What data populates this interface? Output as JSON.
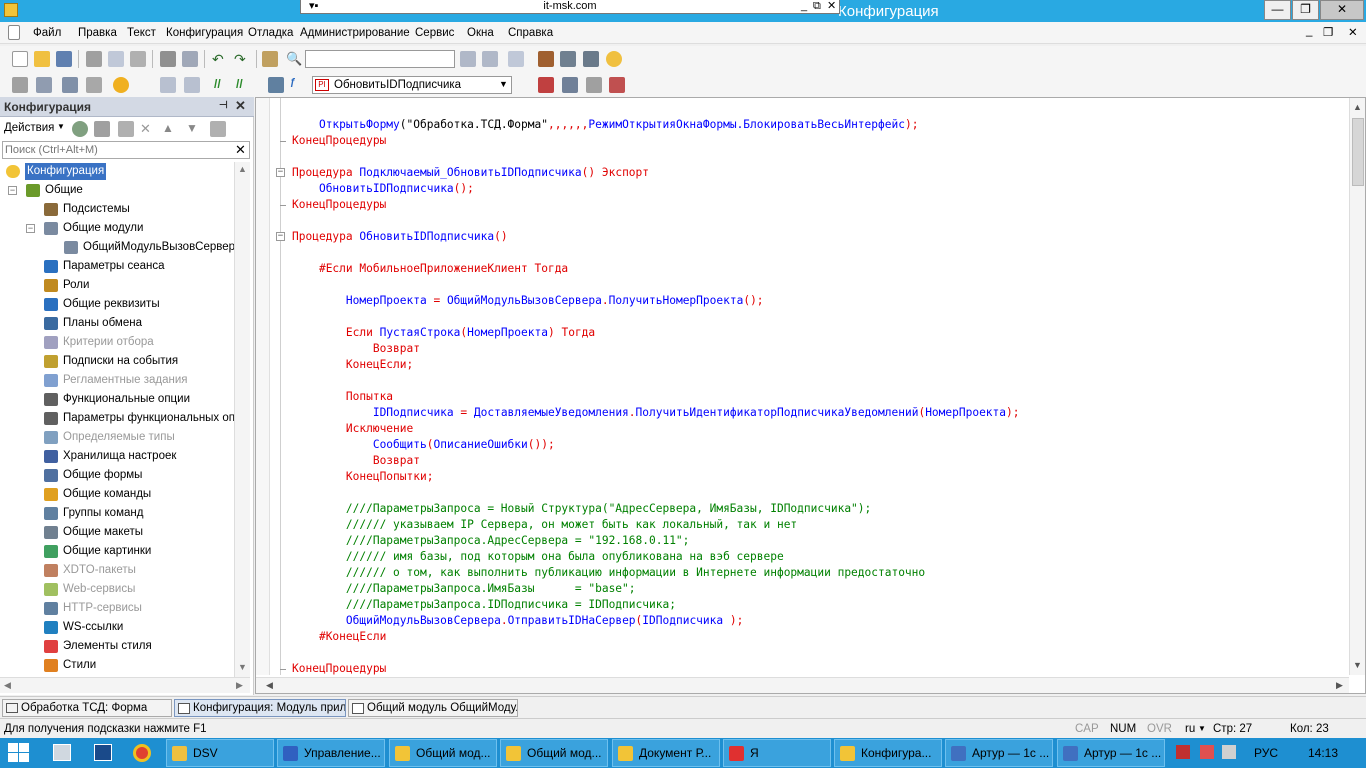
{
  "title_bar": {
    "title": "Конфигурация",
    "rdp_host": "it-msk.com"
  },
  "menu": [
    "Файл",
    "Правка",
    "Текст",
    "Конфигурация",
    "Отладка",
    "Администрирование",
    "Сервис",
    "Окна",
    "Справка"
  ],
  "toolbar": {
    "procedure_select": "ОбновитьIDПодписчика"
  },
  "left_panel": {
    "title": "Конфигурация",
    "actions_label": "Действия",
    "search_placeholder": "Поиск (Ctrl+Alt+M)",
    "tree": [
      {
        "label": "Конфигурация",
        "level": 0,
        "selected": true,
        "grey": false,
        "icon": "config-icon",
        "color": "#f2c437"
      },
      {
        "label": "Общие",
        "level": 0,
        "selected": false,
        "grey": false,
        "icon": "common-icon",
        "color": "#6b9a2a"
      },
      {
        "label": "Подсистемы",
        "level": 1,
        "selected": false,
        "grey": false,
        "icon": "subsystems-icon",
        "color": "#8a6a3a"
      },
      {
        "label": "Общие модули",
        "level": 1,
        "selected": false,
        "grey": false,
        "icon": "module-icon",
        "color": "#7a8aa0"
      },
      {
        "label": "ОбщийМодульВызовСервера",
        "level": 2,
        "selected": false,
        "grey": false,
        "icon": "module-icon",
        "color": "#7a8aa0"
      },
      {
        "label": "Параметры сеанса",
        "level": 1,
        "selected": false,
        "grey": false,
        "icon": "session-params-icon",
        "color": "#2a70c0"
      },
      {
        "label": "Роли",
        "level": 1,
        "selected": false,
        "grey": false,
        "icon": "roles-icon",
        "color": "#c08a20"
      },
      {
        "label": "Общие реквизиты",
        "level": 1,
        "selected": false,
        "grey": false,
        "icon": "attributes-icon",
        "color": "#2a70c0"
      },
      {
        "label": "Планы обмена",
        "level": 1,
        "selected": false,
        "grey": false,
        "icon": "exchange-icon",
        "color": "#3a6aa0"
      },
      {
        "label": "Критерии отбора",
        "level": 1,
        "selected": false,
        "grey": true,
        "icon": "filter-icon",
        "color": "#a0a0c0"
      },
      {
        "label": "Подписки на события",
        "level": 1,
        "selected": false,
        "grey": false,
        "icon": "events-icon",
        "color": "#c0a030"
      },
      {
        "label": "Регламентные задания",
        "level": 1,
        "selected": false,
        "grey": true,
        "icon": "schedule-icon",
        "color": "#80a0d0"
      },
      {
        "label": "Функциональные опции",
        "level": 1,
        "selected": false,
        "grey": false,
        "icon": "options-icon",
        "color": "#606060"
      },
      {
        "label": "Параметры функциональных опций",
        "level": 1,
        "selected": false,
        "grey": false,
        "icon": "options-params-icon",
        "color": "#606060"
      },
      {
        "label": "Определяемые типы",
        "level": 1,
        "selected": false,
        "grey": true,
        "icon": "types-icon",
        "color": "#80a0c0"
      },
      {
        "label": "Хранилища настроек",
        "level": 1,
        "selected": false,
        "grey": false,
        "icon": "storage-icon",
        "color": "#4060a0"
      },
      {
        "label": "Общие формы",
        "level": 1,
        "selected": false,
        "grey": false,
        "icon": "form-icon",
        "color": "#5070a0"
      },
      {
        "label": "Общие команды",
        "level": 1,
        "selected": false,
        "grey": false,
        "icon": "command-icon",
        "color": "#e0a020"
      },
      {
        "label": "Группы команд",
        "level": 1,
        "selected": false,
        "grey": false,
        "icon": "command-group-icon",
        "color": "#6080a0"
      },
      {
        "label": "Общие макеты",
        "level": 1,
        "selected": false,
        "grey": false,
        "icon": "template-icon",
        "color": "#708090"
      },
      {
        "label": "Общие картинки",
        "level": 1,
        "selected": false,
        "grey": false,
        "icon": "picture-icon",
        "color": "#40a060"
      },
      {
        "label": "XDTO-пакеты",
        "level": 1,
        "selected": false,
        "grey": true,
        "icon": "xdto-icon",
        "color": "#c08060"
      },
      {
        "label": "Web-сервисы",
        "level": 1,
        "selected": false,
        "grey": true,
        "icon": "web-service-icon",
        "color": "#a0c060"
      },
      {
        "label": "HTTP-сервисы",
        "level": 1,
        "selected": false,
        "grey": true,
        "icon": "http-service-icon",
        "color": "#6080a0"
      },
      {
        "label": "WS-ссылки",
        "level": 1,
        "selected": false,
        "grey": false,
        "icon": "ws-link-icon",
        "color": "#2080c0"
      },
      {
        "label": "Элементы стиля",
        "level": 1,
        "selected": false,
        "grey": false,
        "icon": "style-item-icon",
        "color": "#e04040"
      },
      {
        "label": "Стили",
        "level": 1,
        "selected": false,
        "grey": false,
        "icon": "styles-icon",
        "color": "#e08020"
      }
    ]
  },
  "editor": {
    "lines": [
      {
        "row": 1,
        "fold": "",
        "segs": [
          [
            "    ",
            "n"
          ],
          [
            "ОткрытьФорму",
            "id"
          ],
          [
            "(\"Обработка.ТСД.Форма\"",
            "n"
          ],
          [
            ",,,,,,",
            "op"
          ],
          [
            "РежимОткрытияОкнаФормы.БлокироватьВесьИнтерфейс",
            "id"
          ],
          [
            ");",
            "op"
          ]
        ]
      },
      {
        "row": 2,
        "fold": "end",
        "segs": [
          [
            "КонецПроцедуры",
            "kw"
          ]
        ]
      },
      {
        "row": 4,
        "fold": "minus",
        "segs": [
          [
            "Процедура ",
            "kw"
          ],
          [
            "Подключаемый_ОбновитьIDПодписчика",
            "id"
          ],
          [
            "() ",
            "op"
          ],
          [
            "Экспорт",
            "kw"
          ]
        ]
      },
      {
        "row": 5,
        "fold": "",
        "segs": [
          [
            "    ",
            "n"
          ],
          [
            "ОбновитьIDПодписчика",
            "id"
          ],
          [
            "();",
            "op"
          ]
        ]
      },
      {
        "row": 6,
        "fold": "end",
        "segs": [
          [
            "КонецПроцедуры",
            "kw"
          ]
        ]
      },
      {
        "row": 8,
        "fold": "minus",
        "segs": [
          [
            "Процедура ",
            "kw"
          ],
          [
            "ОбновитьIDПодписчика",
            "id"
          ],
          [
            "()",
            "op"
          ]
        ]
      },
      {
        "row": 10,
        "fold": "",
        "segs": [
          [
            "    ",
            "n"
          ],
          [
            "#Если МобильноеПриложениеКлиент Тогда",
            "kw"
          ]
        ]
      },
      {
        "row": 12,
        "fold": "",
        "segs": [
          [
            "        ",
            "n"
          ],
          [
            "НомерПроекта",
            "id"
          ],
          [
            " = ",
            "op"
          ],
          [
            "ОбщийМодульВызовСервера",
            "id"
          ],
          [
            ".",
            "op"
          ],
          [
            "ПолучитьНомерПроекта",
            "id"
          ],
          [
            "();",
            "op"
          ]
        ]
      },
      {
        "row": 14,
        "fold": "",
        "segs": [
          [
            "        ",
            "n"
          ],
          [
            "Если ",
            "kw"
          ],
          [
            "ПустаяСтрока",
            "id"
          ],
          [
            "(",
            "op"
          ],
          [
            "НомерПроекта",
            "id"
          ],
          [
            ") ",
            "op"
          ],
          [
            "Тогда",
            "kw"
          ]
        ]
      },
      {
        "row": 15,
        "fold": "",
        "segs": [
          [
            "            ",
            "n"
          ],
          [
            "Возврат",
            "kw"
          ]
        ]
      },
      {
        "row": 16,
        "fold": "",
        "segs": [
          [
            "        ",
            "n"
          ],
          [
            "КонецЕсли;",
            "kw"
          ]
        ]
      },
      {
        "row": 18,
        "fold": "",
        "segs": [
          [
            "        ",
            "n"
          ],
          [
            "Попытка",
            "kw"
          ]
        ]
      },
      {
        "row": 19,
        "fold": "",
        "segs": [
          [
            "            ",
            "n"
          ],
          [
            "IDПодписчика",
            "id"
          ],
          [
            " = ",
            "op"
          ],
          [
            "ДоставляемыеУведомления",
            "id"
          ],
          [
            ".",
            "op"
          ],
          [
            "ПолучитьИдентификаторПодписчикаУведомлений",
            "id"
          ],
          [
            "(",
            "op"
          ],
          [
            "НомерПроекта",
            "id"
          ],
          [
            ");",
            "op"
          ]
        ]
      },
      {
        "row": 20,
        "fold": "",
        "segs": [
          [
            "        ",
            "n"
          ],
          [
            "Исключение",
            "kw"
          ]
        ]
      },
      {
        "row": 21,
        "fold": "",
        "segs": [
          [
            "            ",
            "n"
          ],
          [
            "Сообщить",
            "id"
          ],
          [
            "(",
            "op"
          ],
          [
            "ОписаниеОшибки",
            "id"
          ],
          [
            "());",
            "op"
          ]
        ]
      },
      {
        "row": 22,
        "fold": "",
        "segs": [
          [
            "            ",
            "n"
          ],
          [
            "Возврат",
            "kw"
          ]
        ]
      },
      {
        "row": 23,
        "fold": "",
        "segs": [
          [
            "        ",
            "n"
          ],
          [
            "КонецПопытки;",
            "kw"
          ]
        ]
      },
      {
        "row": 25,
        "fold": "",
        "segs": [
          [
            "        ",
            "n"
          ],
          [
            "////ПараметрыЗапроса = Новый Структура(\"АдресСервера, ИмяБазы, IDПодписчика\");",
            "cm"
          ]
        ]
      },
      {
        "row": 26,
        "fold": "",
        "segs": [
          [
            "        ",
            "n"
          ],
          [
            "////// указываем IP Сервера, он может быть как локальный, так и нет",
            "cm"
          ]
        ]
      },
      {
        "row": 27,
        "fold": "",
        "segs": [
          [
            "        ",
            "n"
          ],
          [
            "////ПараметрыЗапроса.АдресСервера = \"192.168.0.11\";",
            "cm"
          ]
        ]
      },
      {
        "row": 28,
        "fold": "",
        "segs": [
          [
            "        ",
            "n"
          ],
          [
            "////// имя базы, под которым она была опубликована на вэб сервере",
            "cm"
          ]
        ]
      },
      {
        "row": 29,
        "fold": "",
        "segs": [
          [
            "        ",
            "n"
          ],
          [
            "////// о том, как выполнить публикацию информации в Интернете информации предостаточно",
            "cm"
          ]
        ]
      },
      {
        "row": 30,
        "fold": "",
        "segs": [
          [
            "        ",
            "n"
          ],
          [
            "////ПараметрыЗапроса.ИмяБазы      = \"base\";",
            "cm"
          ]
        ]
      },
      {
        "row": 31,
        "fold": "",
        "segs": [
          [
            "        ",
            "n"
          ],
          [
            "////ПараметрыЗапроса.IDПодписчика = IDПодписчика;",
            "cm"
          ]
        ]
      },
      {
        "row": 32,
        "fold": "",
        "segs": [
          [
            "        ",
            "n"
          ],
          [
            "ОбщийМодульВызовСервера",
            "id"
          ],
          [
            ".",
            "op"
          ],
          [
            "ОтправитьIDНаСервер",
            "id"
          ],
          [
            "(",
            "op"
          ],
          [
            "IDПодписчика",
            "id"
          ],
          [
            " );",
            "op"
          ]
        ]
      },
      {
        "row": 33,
        "fold": "",
        "segs": [
          [
            "    ",
            "n"
          ],
          [
            "#КонецЕсли",
            "kw"
          ]
        ]
      },
      {
        "row": 35,
        "fold": "end",
        "segs": [
          [
            "КонецПроцедуры",
            "kw"
          ]
        ]
      }
    ]
  },
  "window_tabs": [
    "Обработка ТСД: Форма",
    "Конфигурация: Модуль прил...",
    "Общий модуль ОбщийМоду..."
  ],
  "status": {
    "hint": "Для получения подсказки нажмите F1",
    "cap": "CAP",
    "num": "NUM",
    "ovr": "OVR",
    "lang": "ru",
    "row": "Стр: 27",
    "col": "Кол: 23"
  },
  "taskbar": {
    "items": [
      {
        "label": "DSV",
        "color": "#f0c040"
      },
      {
        "label": "Управление...",
        "color": "#3060c0"
      },
      {
        "label": "Общий мод...",
        "color": "#f2c437"
      },
      {
        "label": "Общий мод...",
        "color": "#f2c437"
      },
      {
        "label": "Документ Р...",
        "color": "#f2c437"
      },
      {
        "label": "Я",
        "color": "#e03030"
      },
      {
        "label": "Конфигура...",
        "color": "#f2c437"
      },
      {
        "label": "Артур — 1с ...",
        "color": "#4070c0"
      },
      {
        "label": "Артур — 1с ...",
        "color": "#4070c0"
      }
    ],
    "lang": "РУС",
    "clock": "14:13"
  }
}
